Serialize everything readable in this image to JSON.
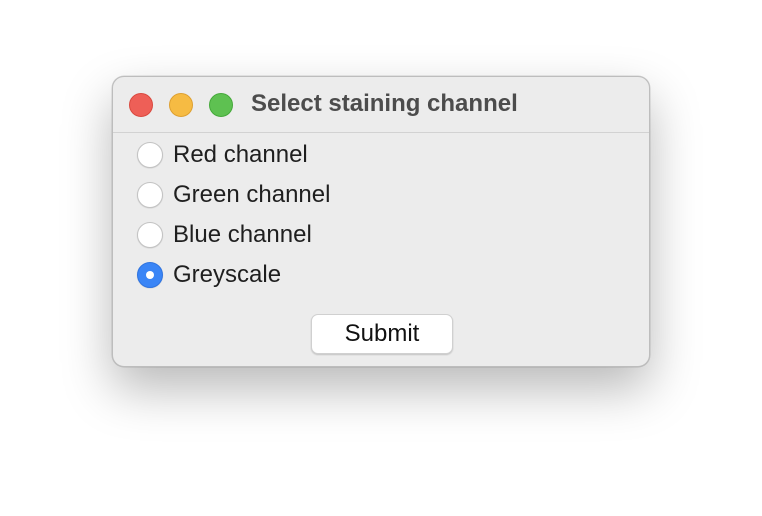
{
  "window": {
    "title": "Select staining channel"
  },
  "options": [
    {
      "label": "Red channel",
      "selected": false
    },
    {
      "label": "Green channel",
      "selected": false
    },
    {
      "label": "Blue channel",
      "selected": false
    },
    {
      "label": "Greyscale",
      "selected": true
    }
  ],
  "buttons": {
    "submit_label": "Submit"
  },
  "colors": {
    "close": "#ee5f57",
    "minimize": "#f6bb43",
    "maximize": "#5ec151",
    "accent": "#3a85f6"
  }
}
